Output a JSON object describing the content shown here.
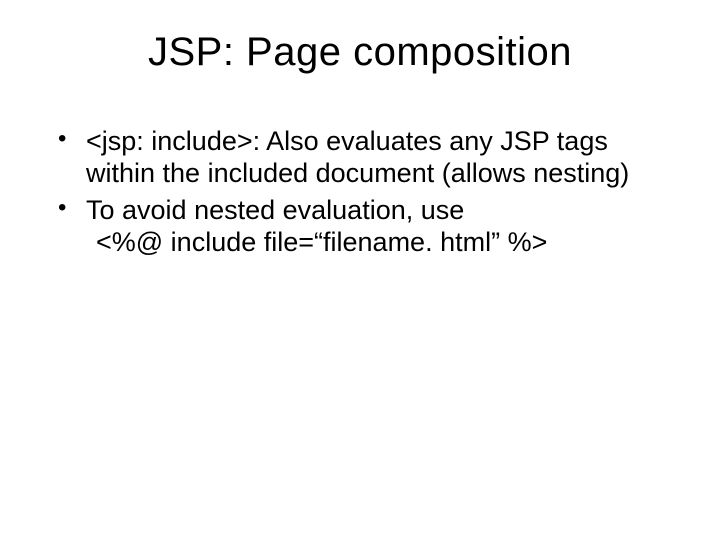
{
  "title": "JSP: Page composition",
  "bullets": [
    {
      "text": "<jsp: include>: Also evaluates any JSP tags within the included document (allows nesting)"
    },
    {
      "text_line1": "To avoid nested evaluation, use",
      "text_line2": "<%@ include file=“filename. html” %>"
    }
  ]
}
